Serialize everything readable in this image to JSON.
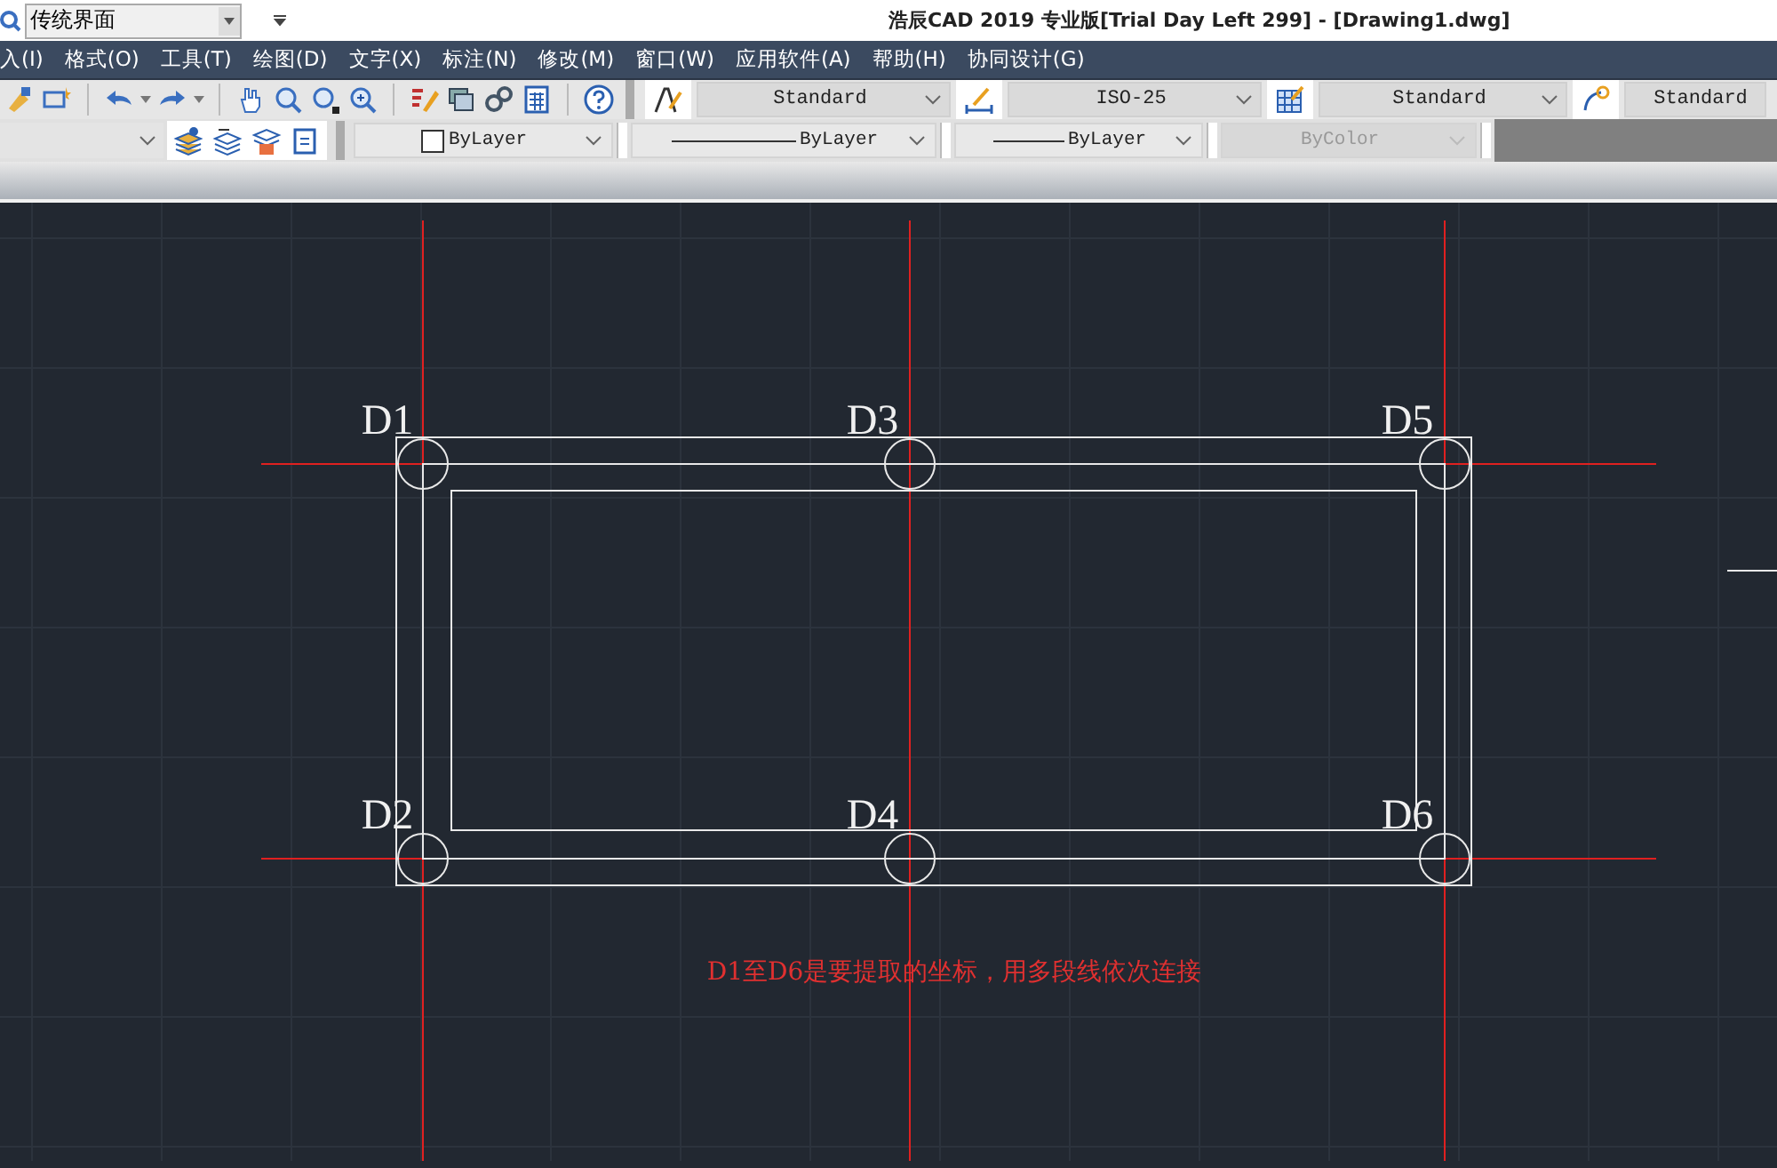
{
  "window": {
    "title": "浩辰CAD 2019 专业版[Trial Day Left 299] - [Drawing1.dwg]"
  },
  "workspace": {
    "value": "传统界面"
  },
  "menu": [
    {
      "label": "入(I)"
    },
    {
      "label": "格式(O)"
    },
    {
      "label": "工具(T)"
    },
    {
      "label": "绘图(D)"
    },
    {
      "label": "文字(X)"
    },
    {
      "label": "标注(N)"
    },
    {
      "label": "修改(M)"
    },
    {
      "label": "窗口(W)"
    },
    {
      "label": "应用软件(A)"
    },
    {
      "label": "帮助(H)"
    },
    {
      "label": "协同设计(G)"
    }
  ],
  "style_dropdowns": [
    {
      "kind": "text",
      "value": "Standard"
    },
    {
      "kind": "dimension",
      "value": "ISO-25"
    },
    {
      "kind": "table",
      "value": "Standard"
    },
    {
      "kind": "multileader",
      "value": "Standard"
    }
  ],
  "property_dropdowns": [
    {
      "kind": "color",
      "value": "ByLayer",
      "disabled": false
    },
    {
      "kind": "linetype",
      "value": "ByLayer",
      "disabled": false
    },
    {
      "kind": "lineweight",
      "value": "ByLayer",
      "disabled": false
    },
    {
      "kind": "plotstyle",
      "value": "ByColor",
      "disabled": true
    }
  ],
  "drawing": {
    "points": [
      "D1",
      "D3",
      "D5",
      "D2",
      "D4",
      "D6"
    ],
    "note": "D1至D6是要提取的坐标，用多段线依次连接"
  }
}
